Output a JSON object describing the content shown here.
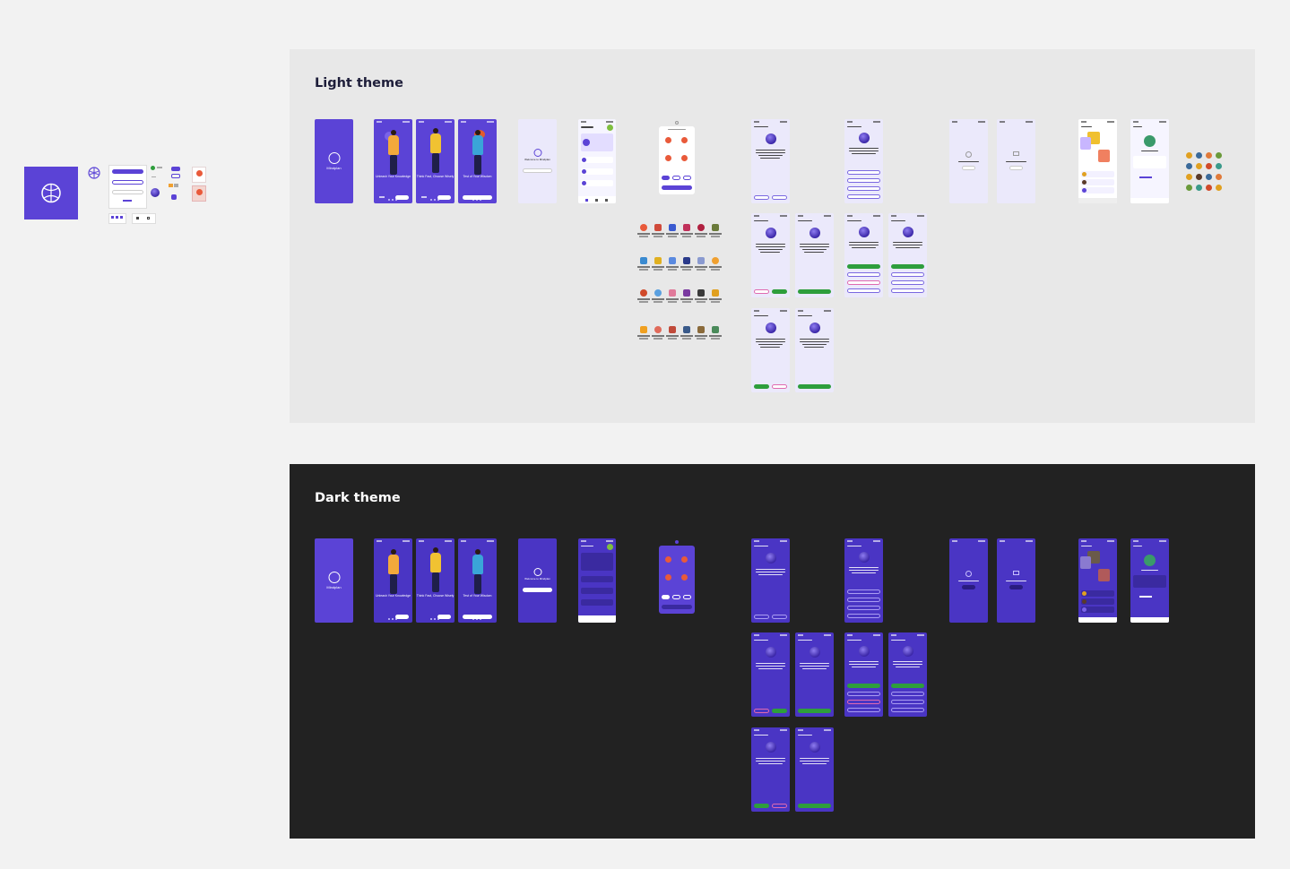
{
  "light_panel": {
    "title": "Light theme",
    "splash_label": "Mindplan",
    "onboarding": [
      {
        "heading": "Unleash Your Knowledge",
        "cta": "Next",
        "skip": "Skip"
      },
      {
        "heading": "Think Fast, Choose Wisely",
        "cta": "Next",
        "skip": "Skip"
      },
      {
        "heading": "Test of Your Wisdom",
        "cta": "Get Started",
        "skip": ""
      }
    ],
    "welcome": {
      "heading": "Welcome to Mindplan",
      "button": "Continue with Google"
    }
  },
  "dark_panel": {
    "title": "Dark theme",
    "splash_label": "Mindplan",
    "welcome": {
      "heading": "Welcome to Mindplan",
      "button": "Continue with Google"
    }
  },
  "colors": {
    "canvas": "#f2f2f2",
    "light_panel_bg": "#e8e8e8",
    "dark_panel_bg": "#222222",
    "brand_purple": "#5b43d6",
    "dark_screen": "#4a35c4",
    "correct_green": "#2e9e3c"
  },
  "icons": [
    "brain-logo-icon",
    "category-icon",
    "avatar-icon",
    "quiz-orb-icon"
  ]
}
